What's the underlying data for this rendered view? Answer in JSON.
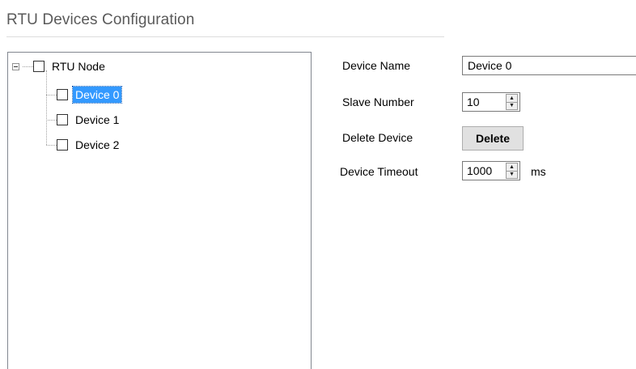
{
  "header": {
    "title": "RTU Devices Configuration"
  },
  "tree": {
    "root": {
      "label": "RTU Node",
      "checked": false,
      "expanded": true
    },
    "children": [
      {
        "label": "Device 0",
        "checked": false,
        "selected": true
      },
      {
        "label": "Device 1",
        "checked": false,
        "selected": false
      },
      {
        "label": "Device 2",
        "checked": false,
        "selected": false
      }
    ]
  },
  "form": {
    "device_name": {
      "label": "Device Name",
      "value": "Device 0"
    },
    "slave_number": {
      "label": "Slave Number",
      "value": "10"
    },
    "delete_device": {
      "label": "Delete Device",
      "button": "Delete"
    },
    "device_timeout": {
      "label": "Device Timeout",
      "value": "1000",
      "unit": "ms"
    }
  },
  "icons": {
    "spin_up": "▲",
    "spin_down": "▼"
  },
  "colors": {
    "selection": "#3399ff"
  }
}
